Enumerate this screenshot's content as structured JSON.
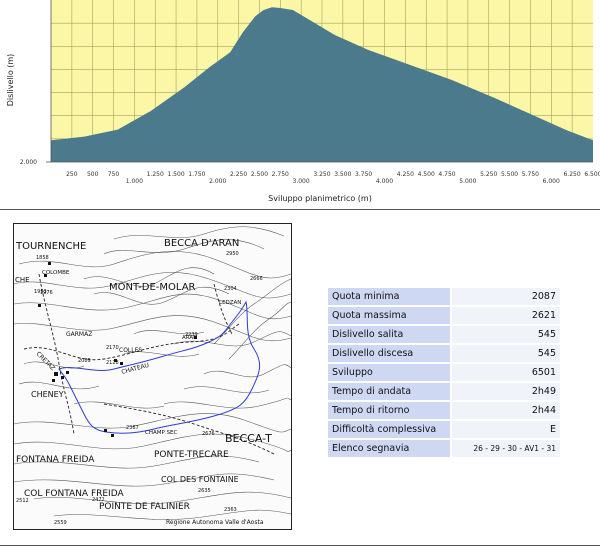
{
  "chart_data": {
    "type": "area",
    "xlabel": "Sviluppo planimetrico (m)",
    "ylabel": "Dislivello (m)",
    "y_tick_label": "2.000",
    "x_ticks_minor": [
      "250",
      "500",
      "750",
      "1.250",
      "1.500",
      "1.750",
      "2.250",
      "2.500",
      "2.750",
      "3.250",
      "3.500",
      "3.750",
      "4.250",
      "4.500",
      "4.750",
      "5.250",
      "5.500",
      "5.750",
      "6.250",
      "6.500"
    ],
    "x_ticks_major": [
      "1.000",
      "2.000",
      "3.000",
      "4.000",
      "5.000",
      "6.000"
    ],
    "xlim": [
      0,
      6501
    ],
    "ylim": [
      2000,
      2650
    ],
    "x": [
      0,
      400,
      800,
      1200,
      1600,
      1900,
      2150,
      2300,
      2450,
      2550,
      2650,
      2750,
      2900,
      3100,
      3400,
      3800,
      4300,
      4800,
      5300,
      5800,
      6200,
      6501
    ],
    "y": [
      2087,
      2102,
      2130,
      2205,
      2300,
      2380,
      2440,
      2520,
      2585,
      2610,
      2621,
      2618,
      2610,
      2570,
      2510,
      2450,
      2390,
      2330,
      2260,
      2185,
      2125,
      2087
    ],
    "fill_color": "#4a7a8c",
    "grid_color": "#a3a35a",
    "background_color": "#fcf7a6"
  },
  "map": {
    "labels": [
      "TOURNENCHE",
      "BECCA D'ARAN",
      "MONT-DE-MOLAR",
      "COLOMBE",
      "LEDZAN",
      "GARMAZ",
      "CRETAZ",
      "COLLES",
      "ARAN",
      "CHATEAU",
      "CHENEY",
      "CHAMP SEC",
      "BECCA-T",
      "PONTE-TRECARE",
      "FONTANA FREIDA",
      "COL FONTANA FREIDA",
      "COL DES FONTAINE",
      "POINTE DE FALINIER",
      "CHE",
      "2950",
      "2666",
      "2304",
      "2239",
      "2170",
      "2128",
      "2089",
      "2387",
      "2676",
      "2635",
      "2472",
      "2512",
      "2559",
      "2363",
      "1953",
      "1976",
      "1858"
    ],
    "credit": "Regione Autonoma Valle d'Aosta"
  },
  "stats": [
    {
      "label": "Quota minima",
      "value": "2087"
    },
    {
      "label": "Quota massima",
      "value": "2621"
    },
    {
      "label": "Dislivello salita",
      "value": "545"
    },
    {
      "label": "Dislivello discesa",
      "value": "545"
    },
    {
      "label": "Sviluppo",
      "value": "6501"
    },
    {
      "label": "Tempo di andata",
      "value": "2h49"
    },
    {
      "label": "Tempo di ritorno",
      "value": "2h44"
    },
    {
      "label": "Difficoltà complessiva",
      "value": "E"
    },
    {
      "label": "Elenco segnavia",
      "value": "26 - 29 - 30 - AV1 - 31"
    }
  ]
}
